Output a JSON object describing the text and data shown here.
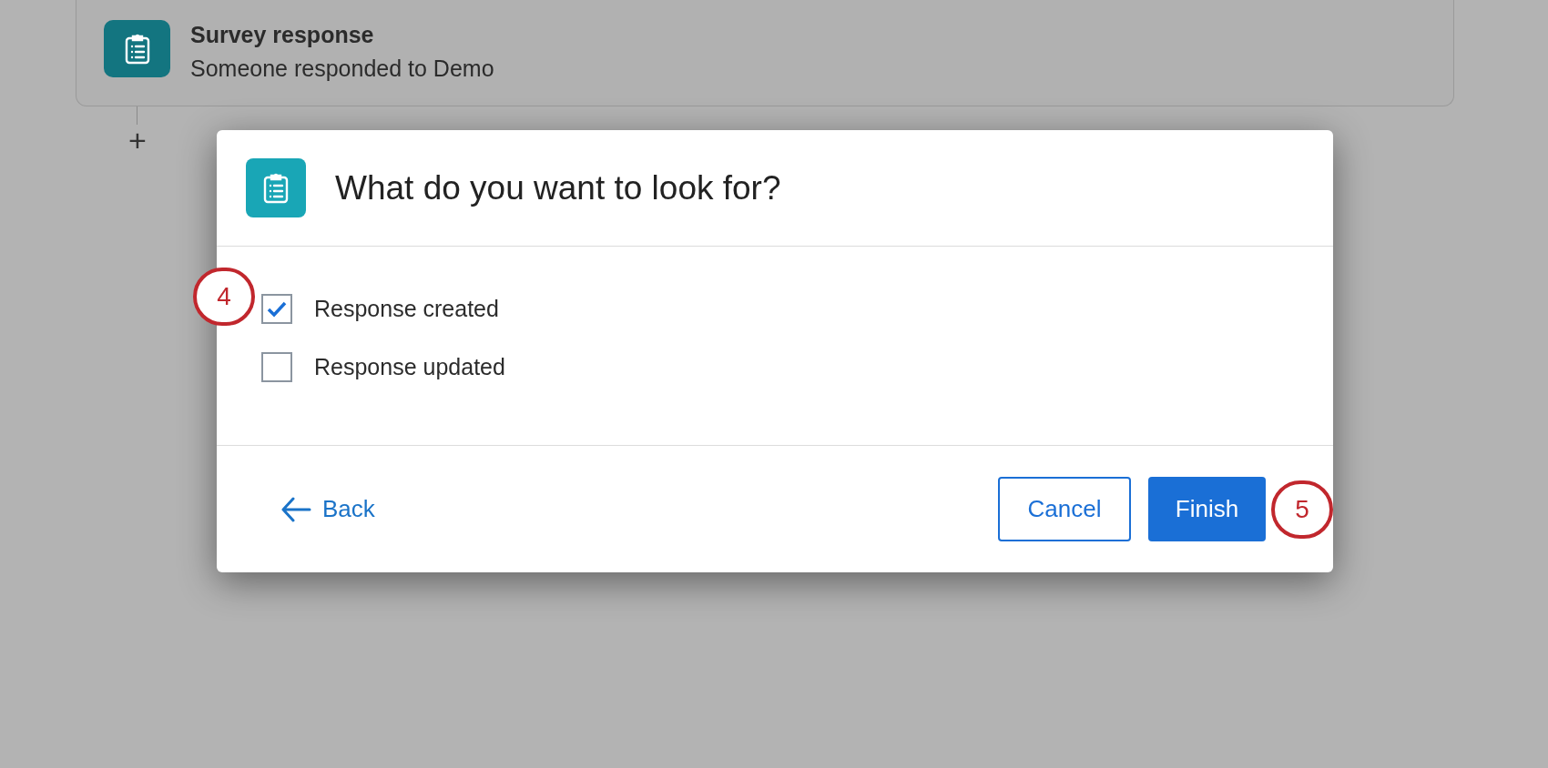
{
  "trigger_card": {
    "title": "Survey response",
    "subtitle": "Someone responded to Demo"
  },
  "add_step": {
    "symbol": "+"
  },
  "dialog": {
    "title": "What do you want to look for?",
    "options": [
      {
        "label": "Response created",
        "checked": true
      },
      {
        "label": "Response updated",
        "checked": false
      }
    ],
    "back": "Back",
    "cancel": "Cancel",
    "finish": "Finish"
  },
  "callouts": [
    {
      "label": "4",
      "kind": "options"
    },
    {
      "label": "5",
      "kind": "finish"
    }
  ]
}
